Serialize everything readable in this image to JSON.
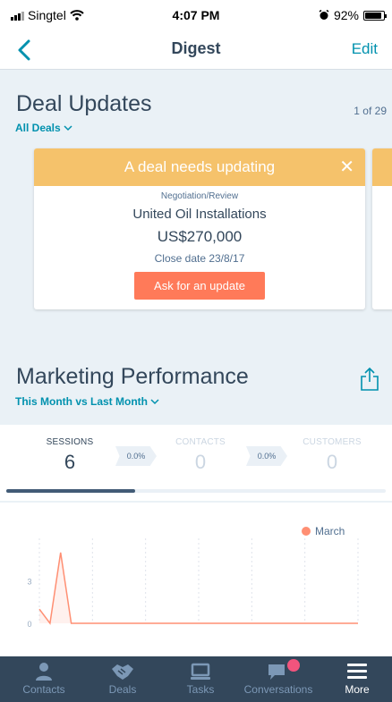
{
  "status_bar": {
    "carrier": "Singtel",
    "time": "4:07 PM",
    "battery_percent": "92%",
    "battery_level": 0.92
  },
  "nav": {
    "title": "Digest",
    "edit_label": "Edit",
    "back_icon": "chevron-left-icon"
  },
  "deal_updates": {
    "title": "Deal Updates",
    "filter_label": "All Deals",
    "pager": "1 of 29",
    "card": {
      "header": "A deal needs updating",
      "stage": "Negotiation/Review",
      "company": "United Oil Installations",
      "amount": "US$270,000",
      "close_date": "Close date 23/8/17",
      "action_label": "Ask for an update"
    }
  },
  "marketing": {
    "title": "Marketing Performance",
    "filter_label": "This Month vs Last Month",
    "stats": [
      {
        "label": "SESSIONS",
        "value": "6",
        "active": true
      },
      {
        "label": "CONTACTS",
        "value": "0",
        "active": false
      },
      {
        "label": "CUSTOMERS",
        "value": "0",
        "active": false
      }
    ],
    "deltas": [
      "0.0%",
      "0.0%"
    ],
    "active_progress": 0.34
  },
  "chart_data": {
    "type": "line",
    "title": "",
    "xlabel": "",
    "ylabel": "",
    "ylim": [
      0,
      6
    ],
    "yticks": [
      "0",
      "3"
    ],
    "grid": true,
    "legend": "top-right",
    "series": [
      {
        "name": "March",
        "color": "#ff8f73",
        "values": [
          1,
          0,
          5,
          0,
          0,
          0,
          0,
          0,
          0,
          0,
          0,
          0,
          0,
          0,
          0,
          0,
          0,
          0,
          0,
          0,
          0,
          0,
          0,
          0,
          0,
          0,
          0,
          0,
          0,
          0,
          0
        ]
      }
    ]
  },
  "tabs": [
    {
      "label": "Contacts",
      "icon": "person-icon",
      "active": false
    },
    {
      "label": "Deals",
      "icon": "handshake-icon",
      "active": false
    },
    {
      "label": "Tasks",
      "icon": "laptop-icon",
      "active": false
    },
    {
      "label": "Conversations",
      "icon": "chat-bubble-icon",
      "active": false,
      "badge": true
    },
    {
      "label": "More",
      "icon": "menu-icon",
      "active": true
    }
  ],
  "colors": {
    "accent": "#0091ae",
    "deal_header": "#f5c26b",
    "action": "#ff7a59",
    "tab_bar": "#33475b",
    "badge": "#f2547d"
  }
}
